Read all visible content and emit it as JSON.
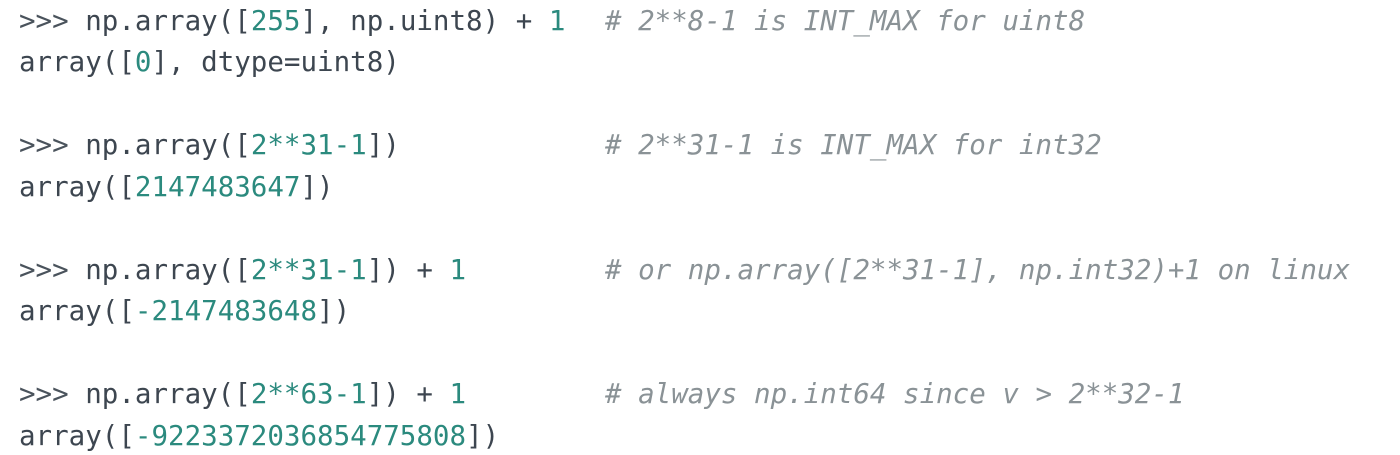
{
  "theme": {
    "code_text": "#3d4650",
    "number_color": "#2b8a7e",
    "comment_color": "#8a9296",
    "background": "#ffffff"
  },
  "blocks": [
    {
      "input": {
        "prompt": ">>> ",
        "pre": "np.array([",
        "num1": "255",
        "mid": "], np.uint8) + ",
        "num2": "1"
      },
      "comment": "# 2**8-1 is INT_MAX for uint8",
      "output": {
        "pre": "array([",
        "num": "0",
        "post": "], dtype=uint8)"
      }
    },
    {
      "input": {
        "prompt": ">>> ",
        "pre": "np.array([",
        "num1": "2**31-1",
        "mid": "])",
        "num2": ""
      },
      "comment": "# 2**31-1 is INT_MAX for int32",
      "output": {
        "pre": "array([",
        "num": "2147483647",
        "post": "])"
      }
    },
    {
      "input": {
        "prompt": ">>> ",
        "pre": "np.array([",
        "num1": "2**31-1",
        "mid": "]) + ",
        "num2": "1"
      },
      "comment": "# or np.array([2**31-1], np.int32)+1 on linux",
      "output": {
        "pre": "array([",
        "num": "-2147483648",
        "post": "])"
      }
    },
    {
      "input": {
        "prompt": ">>> ",
        "pre": "np.array([",
        "num1": "2**63-1",
        "mid": "]) + ",
        "num2": "1"
      },
      "comment": "# always np.int64 since v > 2**32-1",
      "output": {
        "pre": "array([",
        "num": "-9223372036854775808",
        "post": "])"
      }
    }
  ]
}
